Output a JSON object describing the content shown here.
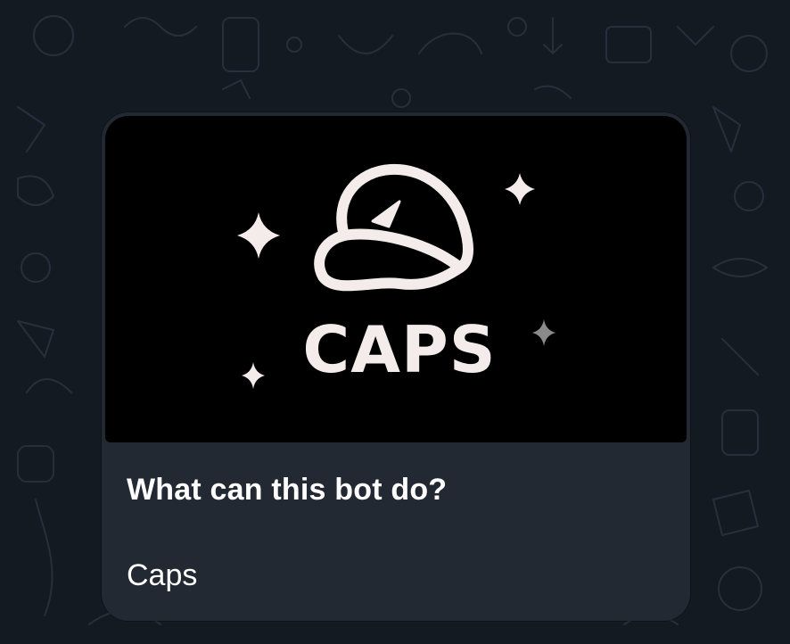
{
  "bot_info": {
    "image": {
      "logo_text": "CAPS",
      "icon": "cap-icon",
      "decorations": "sparkle-icon"
    },
    "title": "What can this bot do?",
    "description": "Caps"
  },
  "colors": {
    "chat_background": "#141a22",
    "card_background": "#222932",
    "image_background": "#000000",
    "logo_color": "#f4ecea",
    "text_color": "#ffffff"
  }
}
